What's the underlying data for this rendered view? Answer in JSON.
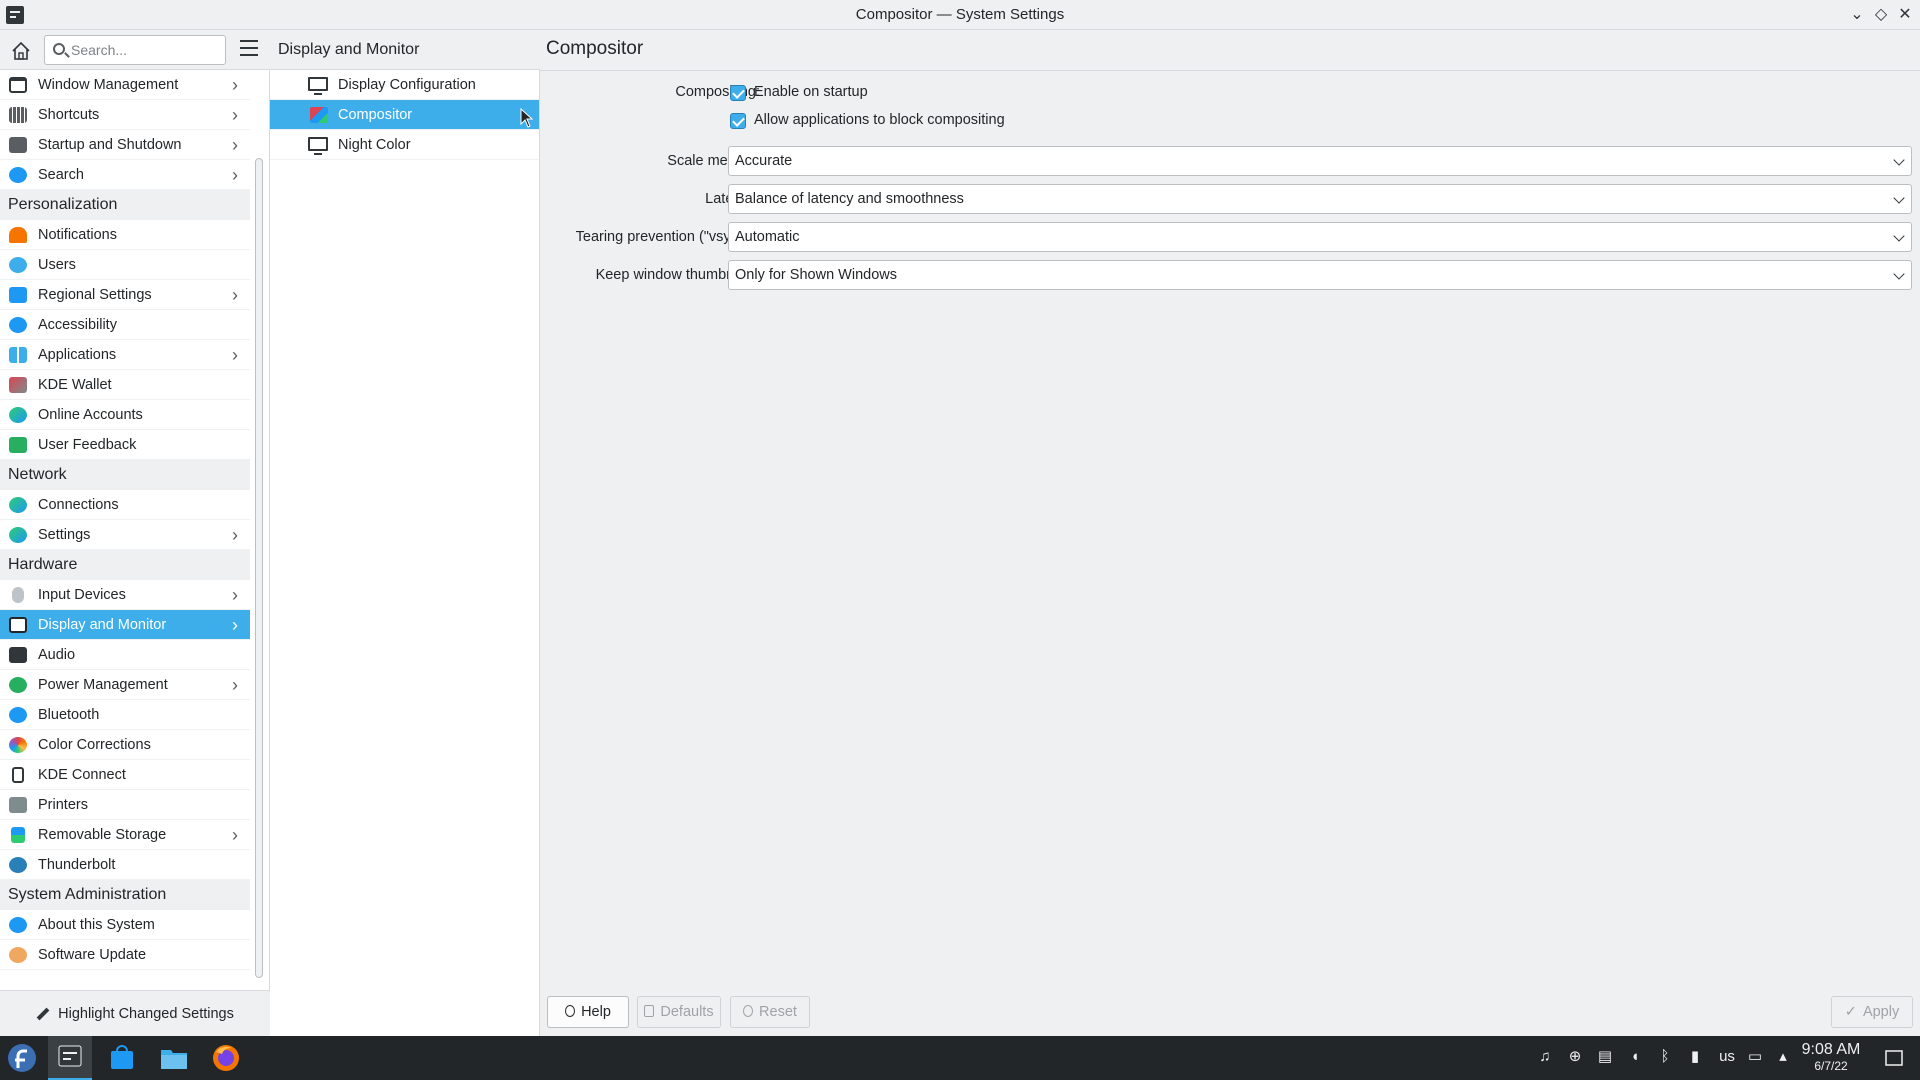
{
  "window": {
    "title": "Compositor — System Settings"
  },
  "search": {
    "placeholder": "Search..."
  },
  "sidebar": {
    "items": [
      {
        "label": "Window Management",
        "chevron": true,
        "color": "#31363b",
        "icon": "window-icon"
      },
      {
        "label": "Shortcuts",
        "chevron": true,
        "color": "#5a5d61",
        "icon": "keyboard-icon"
      },
      {
        "label": "Startup and Shutdown",
        "chevron": true,
        "color": "#5a5d61",
        "icon": "startup-icon"
      },
      {
        "label": "Search",
        "chevron": true,
        "color": "#1d99f3",
        "icon": "search-icon"
      }
    ],
    "categories": {
      "personalization": "Personalization",
      "network": "Network",
      "hardware": "Hardware",
      "sysadmin": "System Administration"
    },
    "personalization": [
      {
        "label": "Notifications",
        "chevron": false
      },
      {
        "label": "Users",
        "chevron": false
      },
      {
        "label": "Regional Settings",
        "chevron": true
      },
      {
        "label": "Accessibility",
        "chevron": false
      },
      {
        "label": "Applications",
        "chevron": true
      },
      {
        "label": "KDE Wallet",
        "chevron": false
      },
      {
        "label": "Online Accounts",
        "chevron": false
      },
      {
        "label": "User Feedback",
        "chevron": false
      }
    ],
    "network": [
      {
        "label": "Connections",
        "chevron": false
      },
      {
        "label": "Settings",
        "chevron": true
      }
    ],
    "hardware": [
      {
        "label": "Input Devices",
        "chevron": true
      },
      {
        "label": "Display and Monitor",
        "chevron": true,
        "selected": true
      },
      {
        "label": "Audio",
        "chevron": false
      },
      {
        "label": "Power Management",
        "chevron": true
      },
      {
        "label": "Bluetooth",
        "chevron": false
      },
      {
        "label": "Color Corrections",
        "chevron": false
      },
      {
        "label": "KDE Connect",
        "chevron": false
      },
      {
        "label": "Printers",
        "chevron": false
      },
      {
        "label": "Removable Storage",
        "chevron": true
      },
      {
        "label": "Thunderbolt",
        "chevron": false
      }
    ],
    "sysadmin": [
      {
        "label": "About this System",
        "chevron": false
      },
      {
        "label": "Software Update",
        "chevron": false
      }
    ],
    "highlight_label": "Highlight Changed Settings"
  },
  "midpanel": {
    "title": "Display and Monitor",
    "items": [
      {
        "label": "Display Configuration"
      },
      {
        "label": "Compositor",
        "selected": true
      },
      {
        "label": "Night Color"
      }
    ]
  },
  "page": {
    "title": "Compositor",
    "compositing_label": "Compositing:",
    "enable_on_startup": {
      "label": "Enable on startup",
      "checked": true
    },
    "allow_block": {
      "label": "Allow applications to block compositing",
      "checked": true
    },
    "scale_method": {
      "label": "Scale method:",
      "value": "Accurate"
    },
    "latency": {
      "label": "Latency:",
      "value": "Balance of latency and smoothness"
    },
    "tearing": {
      "label": "Tearing prevention (\"vsync\"):",
      "value": "Automatic"
    },
    "thumbnails": {
      "label": "Keep window thumbnails:",
      "value": "Only for Shown Windows"
    }
  },
  "buttons": {
    "help": "Help",
    "defaults": "Defaults",
    "reset": "Reset",
    "apply": "Apply"
  },
  "taskbar": {
    "keyboard_layout": "us",
    "time": "9:08 AM",
    "date": "6/7/22"
  },
  "colors": {
    "accent": "#3daee9",
    "taskbar": "#232629",
    "background": "#eff0f1"
  }
}
